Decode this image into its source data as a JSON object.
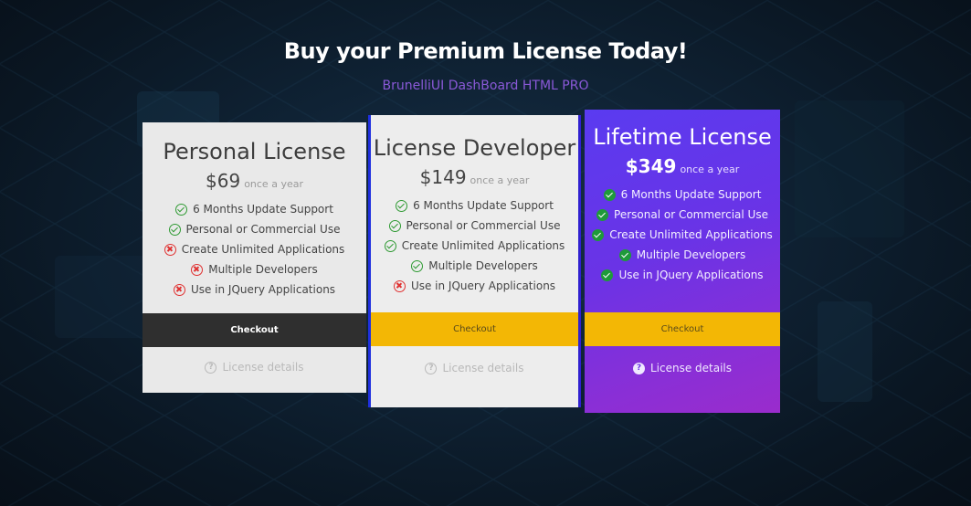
{
  "header": {
    "title": "Buy your Premium License Today!",
    "subtitle": "BrunelliUI DashBoard HTML PRO"
  },
  "icons": {
    "included": "check-circle-icon",
    "excluded": "x-circle-icon",
    "details": "question-circle-icon"
  },
  "colors": {
    "checkout_yellow": "#f3b705",
    "checkout_dark": "#2f2f2f",
    "premium_gradient_start": "#5a3bf0",
    "premium_gradient_end": "#9a2ccc",
    "subtitle_purple": "#8a59d8",
    "check_green": "#2e9a32",
    "cross_red": "#e03131"
  },
  "plans": [
    {
      "name": "Personal License",
      "price": "$69",
      "period": "once a year",
      "features": [
        {
          "label": "6 Months Update Support",
          "included": true
        },
        {
          "label": "Personal or Commercial Use",
          "included": true
        },
        {
          "label": "Create Unlimited Applications",
          "included": false
        },
        {
          "label": "Multiple Developers",
          "included": false
        },
        {
          "label": "Use in JQuery Applications",
          "included": false
        }
      ],
      "checkout_label": "Checkout",
      "details_label": "License details"
    },
    {
      "name": "License Developer",
      "price": "$149",
      "period": "once a year",
      "features": [
        {
          "label": "6 Months Update Support",
          "included": true
        },
        {
          "label": "Personal or Commercial Use",
          "included": true
        },
        {
          "label": "Create Unlimited Applications",
          "included": true
        },
        {
          "label": "Multiple Developers",
          "included": true
        },
        {
          "label": "Use in JQuery Applications",
          "included": false
        }
      ],
      "checkout_label": "Checkout",
      "details_label": "License details"
    },
    {
      "name": "Lifetime License",
      "price": "$349",
      "period": "once a year",
      "features": [
        {
          "label": "6 Months Update Support",
          "included": true
        },
        {
          "label": "Personal or Commercial Use",
          "included": true
        },
        {
          "label": "Create Unlimited Applications",
          "included": true
        },
        {
          "label": "Multiple Developers",
          "included": true
        },
        {
          "label": "Use in JQuery Applications",
          "included": true
        }
      ],
      "checkout_label": "Checkout",
      "details_label": "License details"
    }
  ]
}
